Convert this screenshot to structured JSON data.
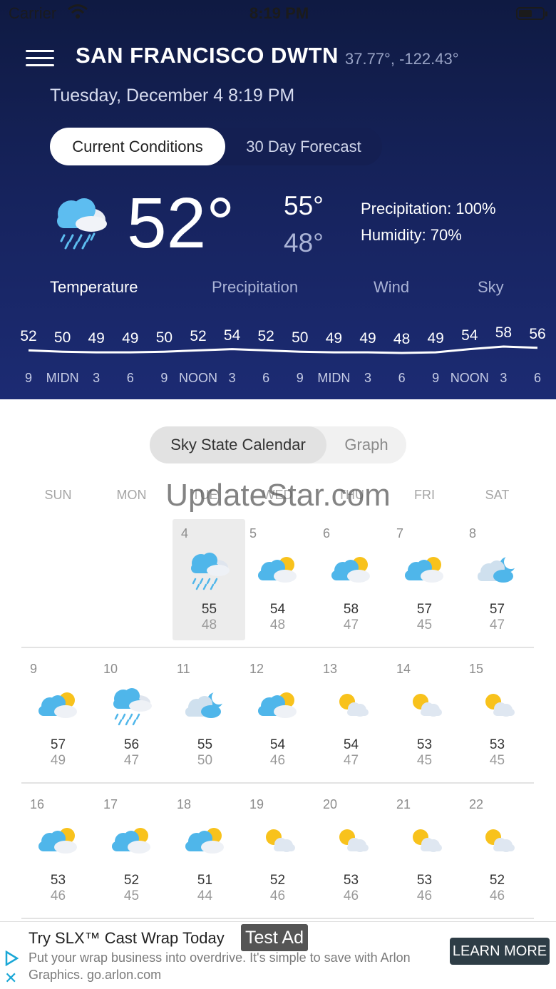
{
  "status_bar": {
    "carrier": "Carrier",
    "time": "8:19 PM"
  },
  "header": {
    "city": "SAN FRANCISCO DWTN",
    "coords": "37.77°, -122.43°",
    "datetime": "Tuesday, December 4 8:19 PM",
    "segment": {
      "active": "Current Conditions",
      "inactive": "30 Day Forecast"
    }
  },
  "current": {
    "icon": "cloud-rain-icon",
    "temp": "52°",
    "high": "55°",
    "low": "48°",
    "precipitation": "Precipitation: 100%",
    "humidity": "Humidity: 70%"
  },
  "tabs": [
    "Temperature",
    "Precipitation",
    "Wind",
    "Sky"
  ],
  "hourly": {
    "temps": [
      "52",
      "50",
      "49",
      "49",
      "50",
      "52",
      "54",
      "52",
      "50",
      "49",
      "49",
      "48",
      "49",
      "54",
      "58",
      "56"
    ],
    "hours": [
      "9",
      "MIDN",
      "3",
      "6",
      "9",
      "NOON",
      "3",
      "6",
      "9",
      "MIDN",
      "3",
      "6",
      "9",
      "NOON",
      "3",
      "6"
    ]
  },
  "calendar": {
    "segment": {
      "active": "Sky State Calendar",
      "inactive": "Graph"
    },
    "days_of_week": [
      "SUN",
      "MON",
      "TUE",
      "WED",
      "THU",
      "FRI",
      "SAT"
    ],
    "watermark": "UpdateStar.com",
    "weeks": [
      [
        null,
        null,
        {
          "day": "4",
          "icon": "cloud-rain",
          "high": "55",
          "low": "48",
          "today": true
        },
        {
          "day": "5",
          "icon": "partly-sunny",
          "high": "54",
          "low": "48"
        },
        {
          "day": "6",
          "icon": "partly-sunny",
          "high": "58",
          "low": "47"
        },
        {
          "day": "7",
          "icon": "partly-sunny",
          "high": "57",
          "low": "45"
        },
        {
          "day": "8",
          "icon": "cloud-moon",
          "high": "57",
          "low": "47"
        }
      ],
      [
        {
          "day": "9",
          "icon": "partly-sunny",
          "high": "57",
          "low": "49"
        },
        {
          "day": "10",
          "icon": "cloud-rain",
          "high": "56",
          "low": "47"
        },
        {
          "day": "11",
          "icon": "cloud-moon",
          "high": "55",
          "low": "50"
        },
        {
          "day": "12",
          "icon": "partly-sunny",
          "high": "54",
          "low": "46"
        },
        {
          "day": "13",
          "icon": "sun-cloud",
          "high": "54",
          "low": "47"
        },
        {
          "day": "14",
          "icon": "sun-cloud",
          "high": "53",
          "low": "45"
        },
        {
          "day": "15",
          "icon": "sun-cloud",
          "high": "53",
          "low": "45"
        }
      ],
      [
        {
          "day": "16",
          "icon": "partly-sunny",
          "high": "53",
          "low": "46"
        },
        {
          "day": "17",
          "icon": "partly-sunny",
          "high": "52",
          "low": "45"
        },
        {
          "day": "18",
          "icon": "partly-sunny",
          "high": "51",
          "low": "44"
        },
        {
          "day": "19",
          "icon": "sun-cloud",
          "high": "52",
          "low": "46"
        },
        {
          "day": "20",
          "icon": "sun-cloud",
          "high": "53",
          "low": "46"
        },
        {
          "day": "21",
          "icon": "sun-cloud",
          "high": "53",
          "low": "46"
        },
        {
          "day": "22",
          "icon": "sun-cloud",
          "high": "52",
          "low": "46"
        }
      ]
    ]
  },
  "ad": {
    "title": "Try SLX™ Cast Wrap Today",
    "badge": "Test Ad",
    "body": "Put your wrap business into overdrive. It's simple to save with Arlon Graphics. go.arlon.com",
    "cta": "LEARN MORE"
  },
  "colors": {
    "hero_top": "#0f1a42",
    "hero_bottom": "#1c2b73",
    "cloud_blue": "#4fb6ea",
    "sun": "#f8c21c"
  }
}
